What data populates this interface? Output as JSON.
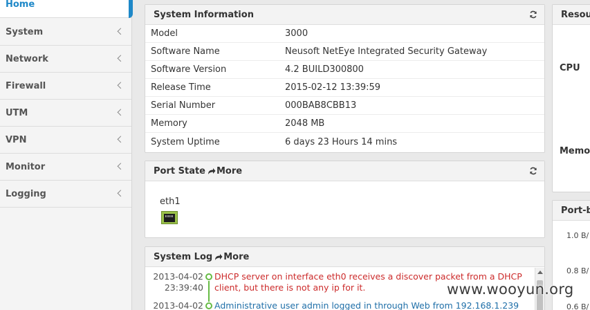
{
  "sidebar": {
    "home": "Home",
    "items": [
      {
        "label": "System"
      },
      {
        "label": "Network"
      },
      {
        "label": "Firewall"
      },
      {
        "label": "UTM"
      },
      {
        "label": "VPN"
      },
      {
        "label": "Monitor"
      },
      {
        "label": "Logging"
      }
    ]
  },
  "system_info": {
    "title": "System Information",
    "rows": [
      {
        "label": "Model",
        "value": "3000"
      },
      {
        "label": "Software Name",
        "value": "Neusoft NetEye Integrated Security Gateway"
      },
      {
        "label": "Software Version",
        "value": "4.2 BUILD300800"
      },
      {
        "label": "Release Time",
        "value": "2015-02-12 13:39:59"
      },
      {
        "label": "Serial Number",
        "value": "000BAB8CBB13"
      },
      {
        "label": "Memory",
        "value": "2048 MB"
      },
      {
        "label": "System Uptime",
        "value": "6 days 23 Hours 14 mins"
      }
    ]
  },
  "port_state": {
    "title": "Port State",
    "more": "More",
    "port_name": "eth1"
  },
  "system_log": {
    "title": "System Log",
    "more": "More",
    "entries": [
      {
        "date": "2013-04-02",
        "time": "23:39:40",
        "message": "DHCP server on interface eth0 receives a discover packet from a DHCP client, but there is not any ip for it."
      },
      {
        "date": "2013-04-02",
        "time": "",
        "message": "Administrative user admin logged in through Web from 192.168.1.239"
      }
    ]
  },
  "resource": {
    "title": "Resou",
    "cpu_label": "CPU",
    "memory_label": "Memor"
  },
  "port_bandwidth": {
    "title": "Port-b",
    "ticks": [
      "1.0 B/",
      "0.8 B/",
      "0.6 B/"
    ]
  },
  "watermark": "www.wooyun.org",
  "colors": {
    "accent": "#1e88c8",
    "log_error": "#cc2b2b",
    "log_info": "#1f6fa8",
    "port_up": "#9bc24a"
  }
}
